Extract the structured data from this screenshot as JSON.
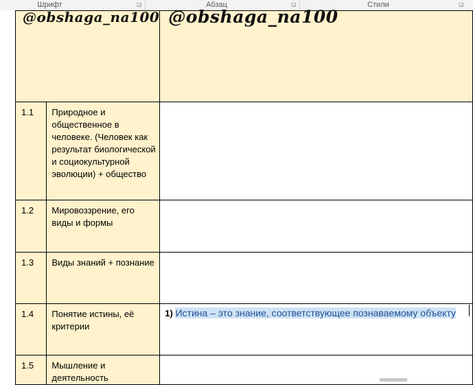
{
  "ribbon": {
    "groups": [
      {
        "label": "Шрифт"
      },
      {
        "label": "Абзац"
      },
      {
        "label": "Стили"
      }
    ],
    "launcher_icon": "dialog-launcher-icon"
  },
  "header": {
    "logo_left": "@obshaga_na100",
    "logo_right": "@obshaga_na100"
  },
  "rows": [
    {
      "num": "1.1",
      "topic": "Природное и общественное в человеке. (Человек как результат биологической и социокультурной эволюции) + общество",
      "content": ""
    },
    {
      "num": "1.2",
      "topic": "Мировоззрение, его виды и формы",
      "content": ""
    },
    {
      "num": "1.3",
      "topic": "Виды знаний + познание",
      "content": ""
    },
    {
      "num": "1.4",
      "topic": "Понятие истины, её критерии",
      "content_number": "1)",
      "content": "Истина – это знание, соответствующее познаваемому объекту"
    },
    {
      "num": "1.5",
      "topic": "Мышление и деятельность",
      "content": ""
    }
  ],
  "colors": {
    "highlight": "#cfe3f5",
    "highlight_text": "#1f4e96",
    "topic_background": "#fff2cc"
  }
}
